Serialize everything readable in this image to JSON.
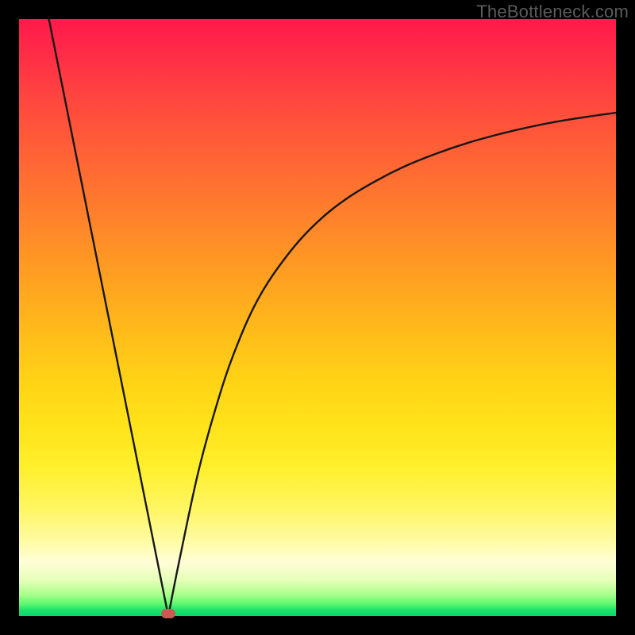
{
  "watermark": "TheBottleneck.com",
  "colors": {
    "frame_border": "#000000",
    "curve_stroke": "#161616",
    "marker_fill": "#c85a52"
  },
  "chart_data": {
    "type": "line",
    "title": "",
    "xlabel": "",
    "ylabel": "",
    "xlim": [
      0,
      100
    ],
    "ylim": [
      0,
      100
    ],
    "grid": false,
    "legend": false,
    "notes": "V-shaped bottleneck curve; minimum near x≈25 at y≈0; left branch descends from (5,100) to (25,0) nearly linearly; right branch rises asymptotically toward y≈85 at x=100.",
    "series": [
      {
        "name": "curve",
        "x": [
          5,
          10,
          15,
          20,
          23,
          25,
          27,
          30,
          33,
          36,
          40,
          45,
          50,
          55,
          60,
          65,
          70,
          75,
          80,
          85,
          90,
          95,
          100
        ],
        "y": [
          100,
          75,
          50,
          25,
          10,
          0,
          10,
          24,
          35,
          44,
          53,
          60.5,
          66,
          70,
          73,
          75.5,
          77.5,
          79.2,
          80.6,
          81.8,
          82.8,
          83.6,
          84.3
        ]
      }
    ],
    "marker": {
      "x": 25,
      "y": 0,
      "label": ""
    }
  }
}
